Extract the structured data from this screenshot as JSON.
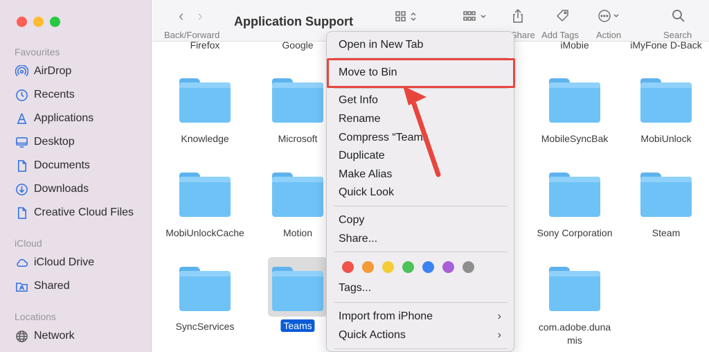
{
  "sidebar": {
    "favourites_title": "Favourites",
    "icloud_title": "iCloud",
    "locations_title": "Locations",
    "items": [
      {
        "label": "AirDrop",
        "icon": "airdrop-icon"
      },
      {
        "label": "Recents",
        "icon": "clock-icon"
      },
      {
        "label": "Applications",
        "icon": "applications-icon"
      },
      {
        "label": "Desktop",
        "icon": "desktop-icon"
      },
      {
        "label": "Documents",
        "icon": "document-icon"
      },
      {
        "label": "Downloads",
        "icon": "download-icon"
      },
      {
        "label": "Creative Cloud Files",
        "icon": "file-icon"
      }
    ],
    "icloud_items": [
      {
        "label": "iCloud Drive",
        "icon": "cloud-icon"
      },
      {
        "label": "Shared",
        "icon": "shared-folder-icon"
      }
    ],
    "location_items": [
      {
        "label": "Network",
        "icon": "globe-icon"
      }
    ]
  },
  "toolbar": {
    "title": "Application Support",
    "back_forward_label": "Back/Forward",
    "share_label": "Share",
    "add_tags_label": "Add Tags",
    "action_label": "Action",
    "search_label": "Search"
  },
  "files": {
    "top_cut": [
      "Firefox",
      "Google",
      "iMobie",
      "iMyFone D-Back"
    ],
    "row1": [
      "Knowledge",
      "Microsoft",
      "MobileSyncBak",
      "MobiUnlock"
    ],
    "row2": [
      "MobiUnlockCache",
      "Motion",
      "Sony Corporation",
      "Steam"
    ],
    "row3": [
      "SyncServices",
      "Teams",
      "com.adobe.duna",
      "mis"
    ]
  },
  "menu": {
    "open_new_tab": "Open in New Tab",
    "move_to_bin": "Move to Bin",
    "get_info": "Get Info",
    "rename": "Rename",
    "compress": "Compress “Teams",
    "duplicate": "Duplicate",
    "make_alias": "Make Alias",
    "quick_look": "Quick Look",
    "copy": "Copy",
    "share": "Share...",
    "tags": "Tags...",
    "import_iphone": "Import from iPhone",
    "quick_actions": "Quick Actions",
    "tag_colors": [
      "#f0524c",
      "#f49a37",
      "#f5cc35",
      "#4dc257",
      "#3a84f2",
      "#a860d8",
      "#8e8e8e"
    ]
  },
  "colors": {
    "accent": "#0a5bd6",
    "annotation": "#e8463d",
    "folder": "#6ec2f6"
  }
}
